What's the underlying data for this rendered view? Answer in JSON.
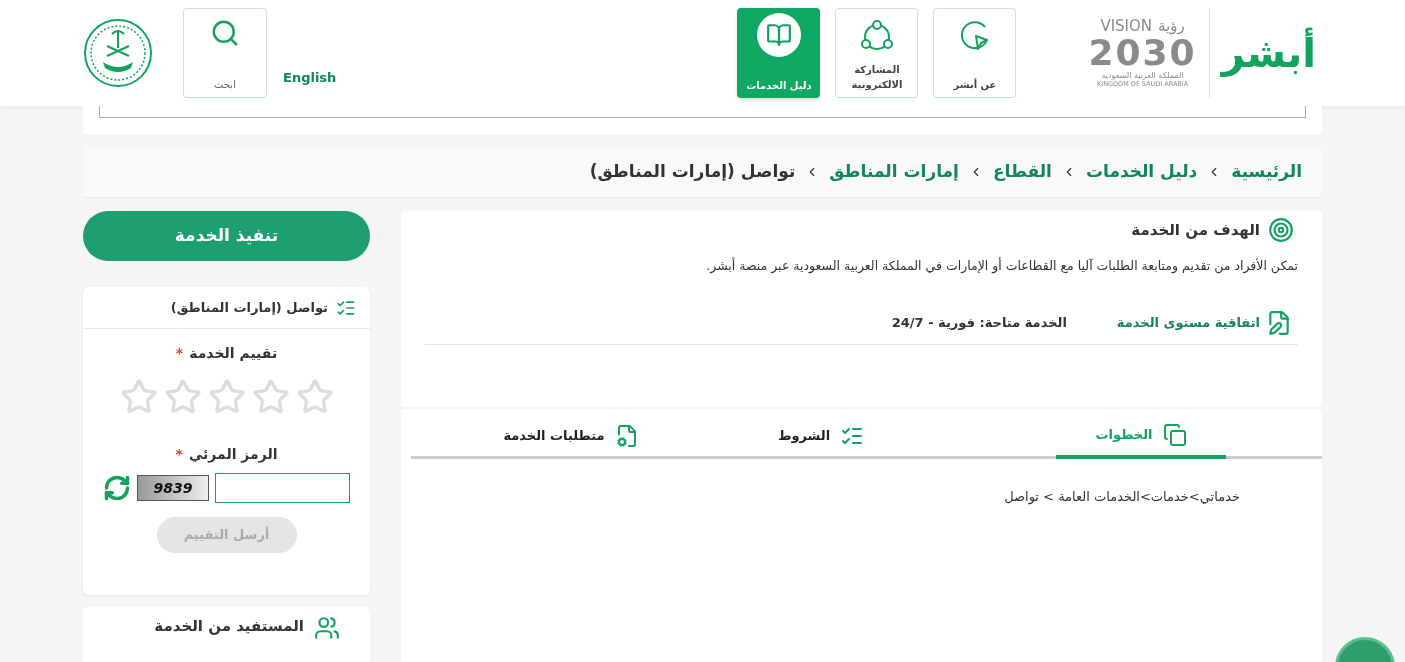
{
  "header": {
    "absher_logo": "أبشر",
    "vision_logo": {
      "word_en": "VISION",
      "word_ar": "رؤية",
      "year": "2030",
      "country_ar": "المملكة العربية السعودية",
      "country_en": "KINGDOM OF SAUDI ARABIA"
    },
    "nav": [
      {
        "kind": "about",
        "label": "عن أبشر",
        "selected": false
      },
      {
        "kind": "participation",
        "label": "المشاركة الالكترونية",
        "selected": false
      },
      {
        "kind": "guide",
        "label": "دليل الخدمات",
        "selected": true
      }
    ],
    "language": "English",
    "search": {
      "label": "ابحث"
    }
  },
  "breadcrumb": [
    {
      "label": "الرئيسية",
      "current": false
    },
    {
      "label": "دليل الخدمات",
      "current": false
    },
    {
      "label": "القطاع",
      "current": false
    },
    {
      "label": "إمارات المناطق",
      "current": false
    },
    {
      "label": "تواصل (إمارات المناطق)",
      "current": true
    }
  ],
  "goal": {
    "title": "الهدف من الخدمة",
    "description": "تمكن الأفراد من تقديم ومتابعة الطلبات آليا مع القطاعات أو الإمارات في المملكة العربية السعودية عبر منصة أبشر.",
    "sla": "اتفاقية مستوى الخدمة",
    "availability": "الخدمة متاحة: فورية - 24/7"
  },
  "tabs": [
    {
      "kind": "steps",
      "label": "الخطوات",
      "selected": true
    },
    {
      "kind": "terms",
      "label": "الشروط",
      "selected": false
    },
    {
      "kind": "requirements",
      "label": "متطلبات الخدمة",
      "selected": false
    }
  ],
  "steps_text": "خدماتي>خدمات>الخدمات العامة > تواصل",
  "execute_button": "تنفيذ الخدمة",
  "rating_card": {
    "title": "تواصل (إمارات المناطق)",
    "rating_label": "تقييم الخدمة",
    "rating_required": "*",
    "stars": 0,
    "captcha_label": "الرمز المرئي",
    "captcha_required": "*",
    "captcha_image_text": "9839",
    "submit": {
      "label": "أرسل التقييم",
      "disabled": true
    }
  },
  "beneficiary_card": {
    "title": "المستفيد من الخدمة"
  }
}
